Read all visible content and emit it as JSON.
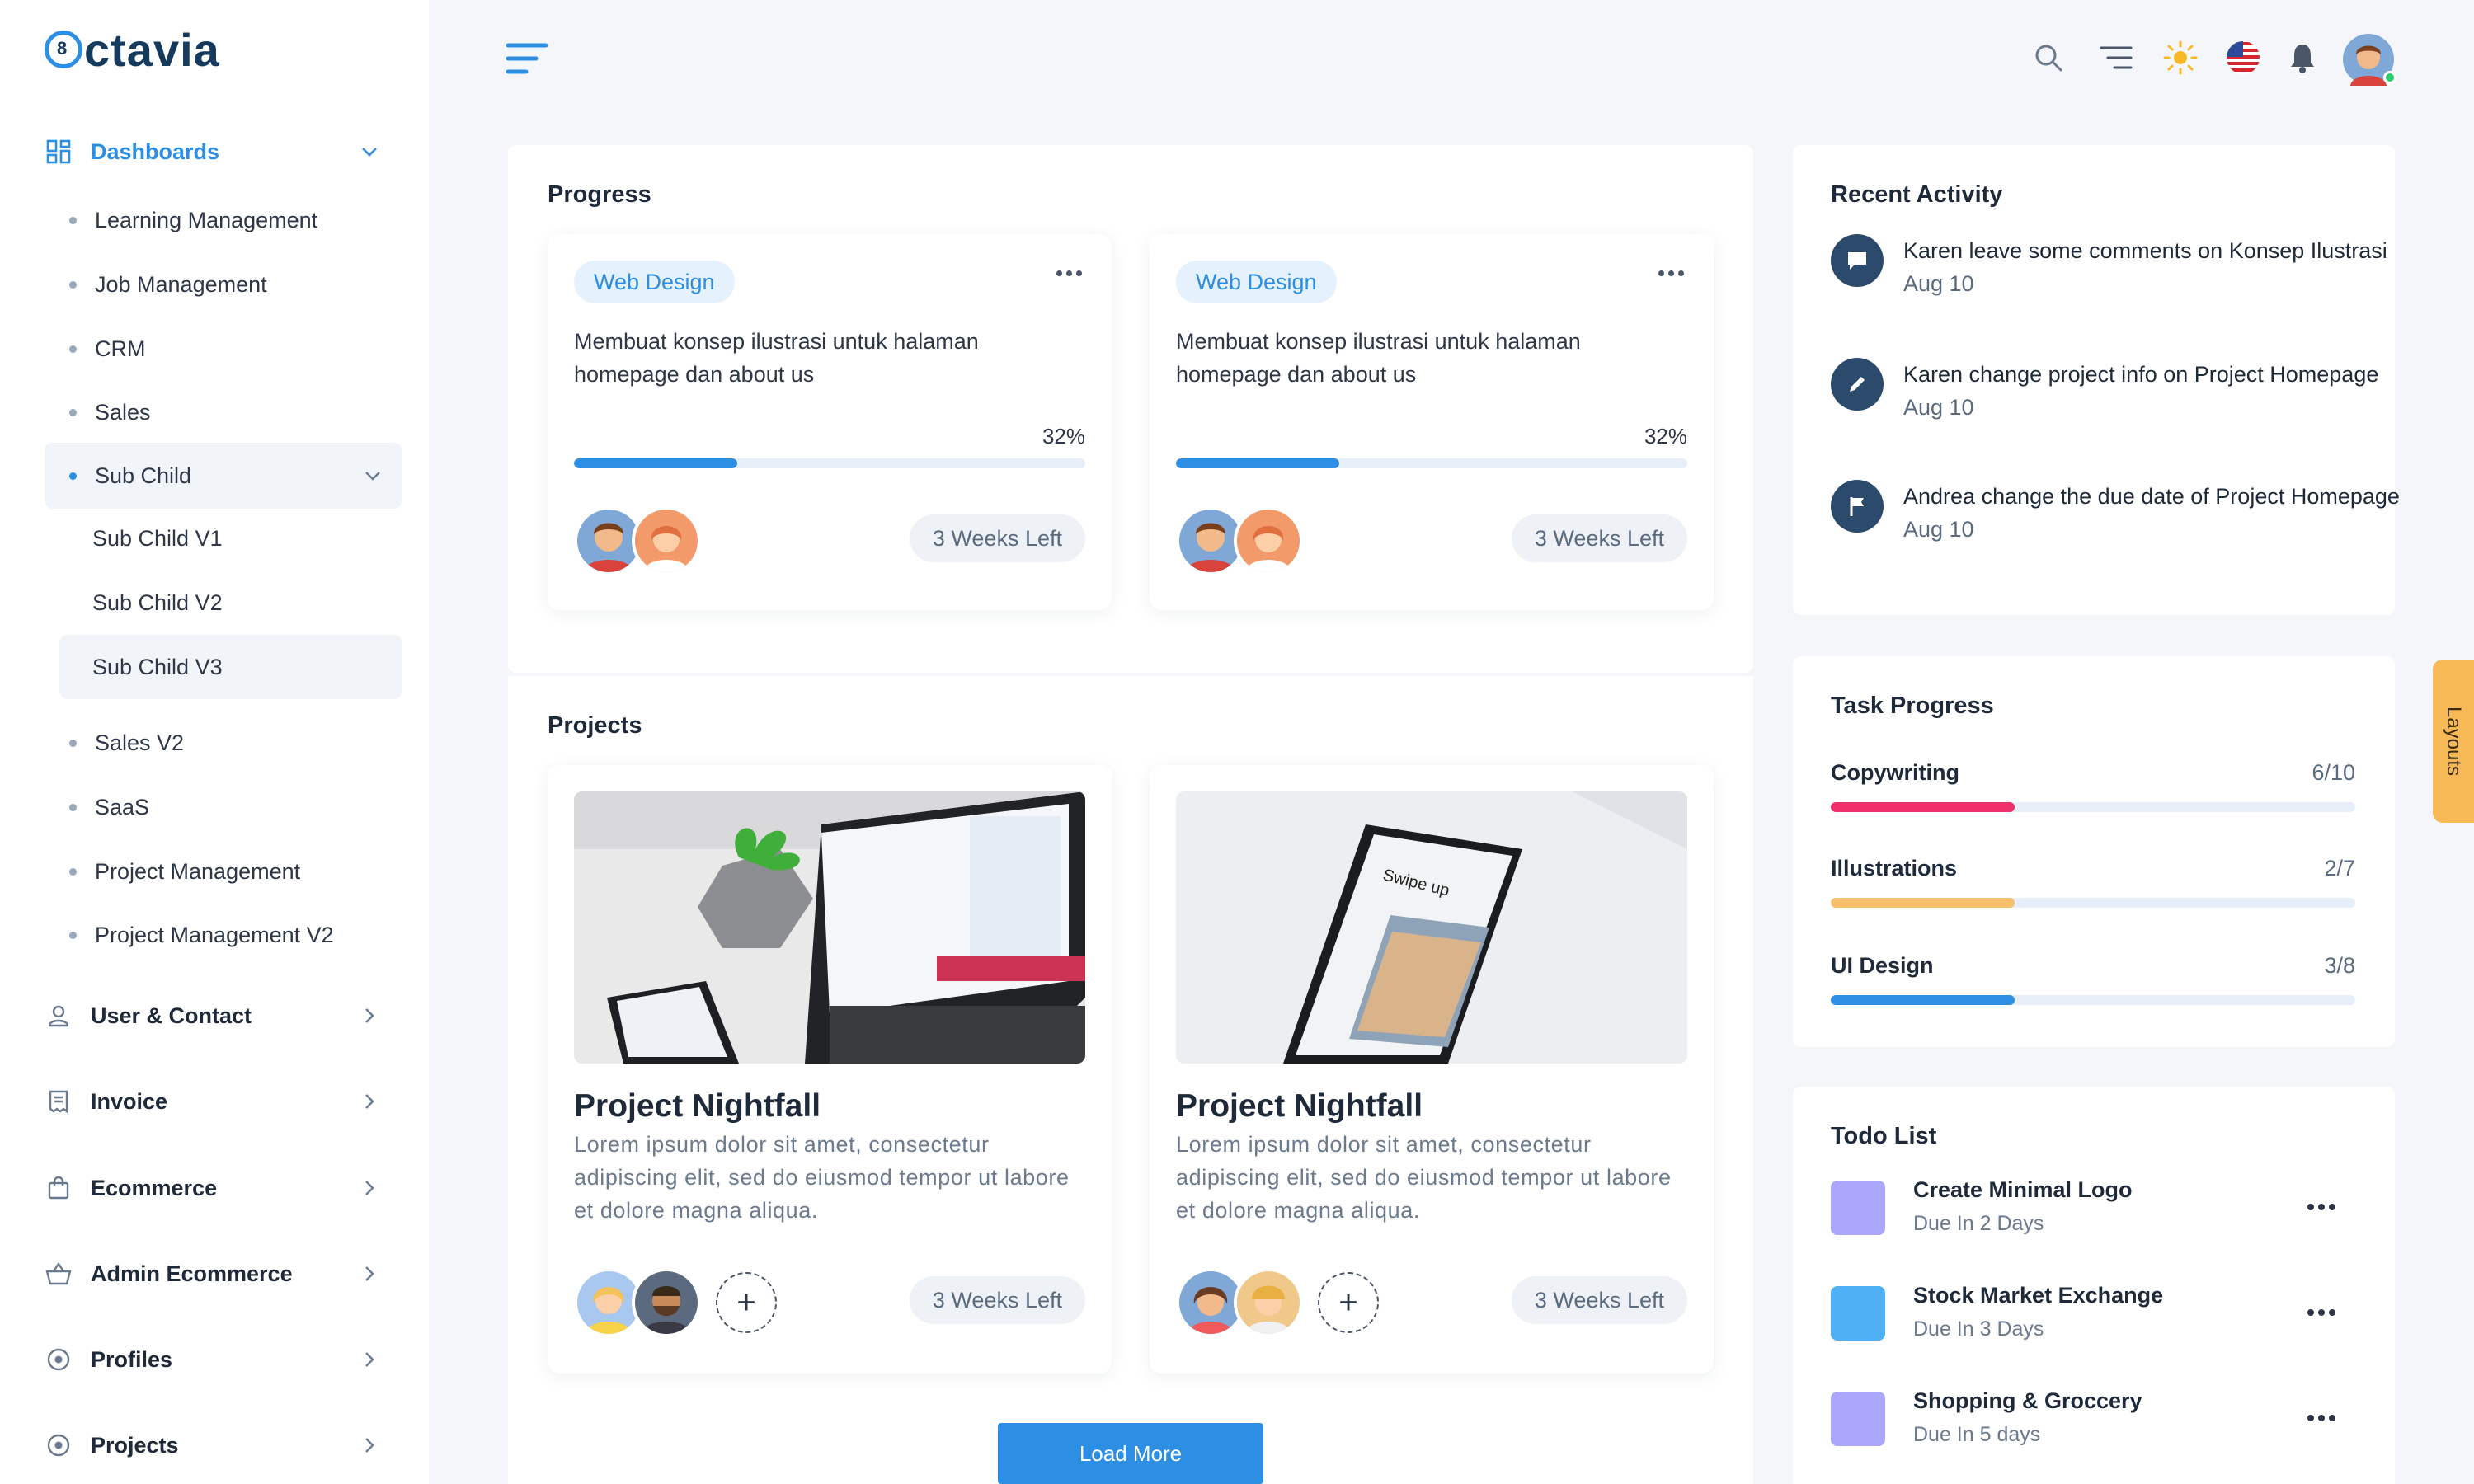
{
  "brand": {
    "name": "ctavia"
  },
  "sidebar": {
    "dashboards_label": "Dashboards",
    "sub_items": [
      "Learning Management",
      "Job Management",
      "CRM",
      "Sales",
      "Sub Child"
    ],
    "sub_children": [
      "Sub Child V1",
      "Sub Child V2",
      "Sub Child V3"
    ],
    "more_items": [
      "Sales V2",
      "SaaS",
      "Project Management",
      "Project Management V2"
    ],
    "sections": [
      "User & Contact",
      "Invoice",
      "Ecommerce",
      "Admin Ecommerce",
      "Profiles",
      "Projects"
    ]
  },
  "progress": {
    "title": "Progress",
    "cards": [
      {
        "tag": "Web Design",
        "desc": "Membuat konsep ilustrasi untuk halaman homepage dan about us",
        "percent_label": "32%",
        "percent": 32,
        "weeks": "3 Weeks Left"
      },
      {
        "tag": "Web Design",
        "desc": "Membuat konsep ilustrasi untuk halaman homepage dan about us",
        "percent_label": "32%",
        "percent": 32,
        "weeks": "3 Weeks Left"
      }
    ]
  },
  "projects": {
    "title": "Projects",
    "cards": [
      {
        "name": "Project Nightfall",
        "desc": "Lorem ipsum dolor sit amet, consectetur adipiscing elit, sed do eiusmod tempor ut labore et dolore magna aliqua.",
        "weeks": "3 Weeks Left"
      },
      {
        "name": "Project Nightfall",
        "desc": "Lorem ipsum dolor sit amet, consectetur adipiscing elit, sed do eiusmod tempor ut labore et dolore magna aliqua.",
        "weeks": "3 Weeks Left",
        "phone_text": "Swipe up"
      }
    ],
    "load_more": "Load More"
  },
  "recent_activity": {
    "title": "Recent Activity",
    "items": [
      {
        "text": "Karen leave some comments on Konsep Ilustrasi",
        "date": "Aug 10",
        "icon": "comment-icon"
      },
      {
        "text": "Karen change project info on Project Homepage",
        "date": "Aug 10",
        "icon": "edit-icon"
      },
      {
        "text": "Andrea change the due date of Project Homepage",
        "date": "Aug 10",
        "icon": "flag-icon"
      }
    ]
  },
  "task_progress": {
    "title": "Task Progress",
    "items": [
      {
        "label": "Copywriting",
        "count": "6/10",
        "fraction": 0.35,
        "color": "#f0306b"
      },
      {
        "label": "Illustrations",
        "count": "2/7",
        "fraction": 0.35,
        "color": "#f7c16b"
      },
      {
        "label": "UI Design",
        "count": "3/8",
        "fraction": 0.35,
        "color": "#2c8fe3"
      }
    ]
  },
  "todo": {
    "title": "Todo List",
    "items": [
      {
        "title": "Create Minimal Logo",
        "due": "Due In 2 Days",
        "color": "#a9a6fb"
      },
      {
        "title": "Stock Market Exchange",
        "due": "Due In 3 Days",
        "color": "#4fb0f5"
      },
      {
        "title": "Shopping & Groccery",
        "due": "Due In 5 days",
        "color": "#a9a6fb"
      }
    ]
  },
  "layouts_tab": "Layouts",
  "colors": {
    "accent": "#2c8fe3",
    "dark": "#163a5c"
  }
}
